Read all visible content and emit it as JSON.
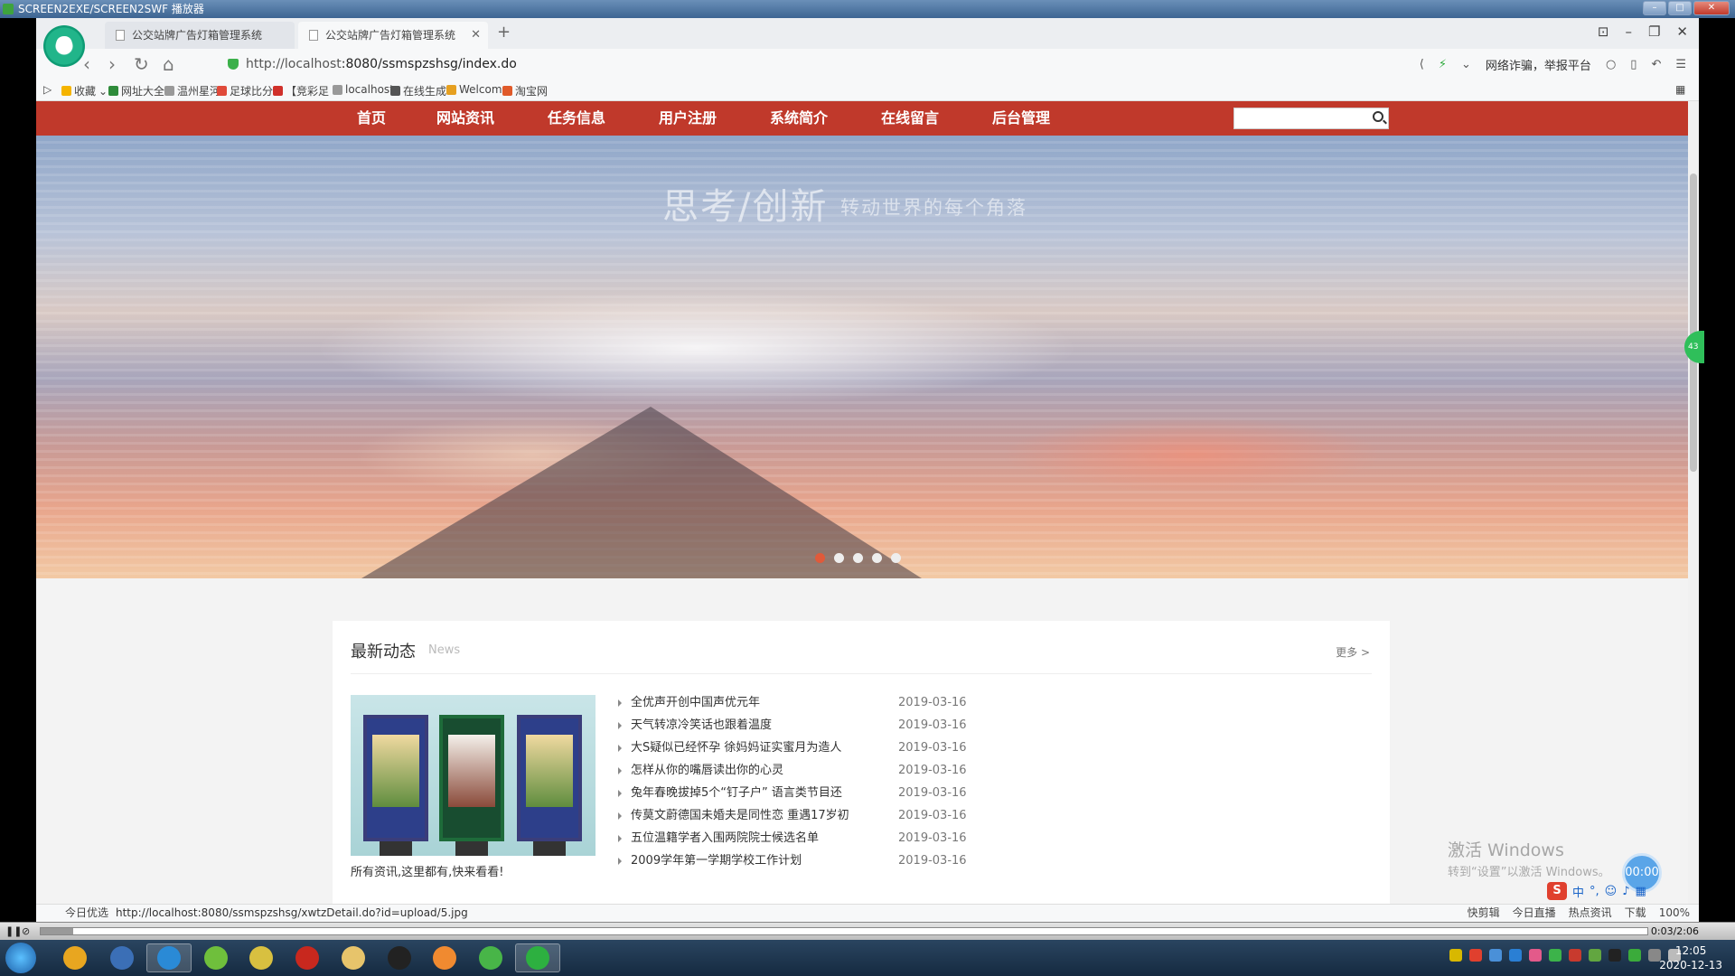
{
  "player": {
    "title": "SCREEN2EXE/SCREEN2SWF 播放器",
    "time": "0:03/2:06"
  },
  "browser": {
    "tabs": [
      {
        "label": "公交站牌广告灯箱管理系统",
        "active": false
      },
      {
        "label": "公交站牌广告灯箱管理系统",
        "active": true
      }
    ],
    "url_host": "http://localhost",
    "url_rest": ":8080/ssmspzshsg/index.do",
    "fraud_report": "网络诈骗，举报平台",
    "bookmarks": [
      "收藏",
      "网址大全",
      "温州星河",
      "足球比分",
      "【竞彩足",
      "localhost",
      "在线生成",
      "Welcom",
      "淘宝网"
    ],
    "bookmark_colors": [
      "#f5b400",
      "#2e8b3a",
      "#999999",
      "#e04a3a",
      "#d0302a",
      "#999999",
      "#555555",
      "#e6a020",
      "#e05a2a"
    ]
  },
  "site": {
    "menu": [
      "首页",
      "网站资讯",
      "任务信息",
      "用户注册",
      "系统简介",
      "在线留言",
      "后台管理"
    ],
    "search_placeholder": "",
    "banner": {
      "title": "思考/创新",
      "subtitle": "转动世界的每个角落",
      "slide_count": 5,
      "active_slide": 0
    },
    "news": {
      "title": "最新动态",
      "title_en": "News",
      "more": "更多 >",
      "caption": "所有资讯,这里都有,快来看看!",
      "items": [
        {
          "title": "全优声开创中国声优元年",
          "date": "2019-03-16"
        },
        {
          "title": "天气转凉冷笑话也跟着温度",
          "date": "2019-03-16"
        },
        {
          "title": "大S疑似已经怀孕 徐妈妈证实蜜月为造人",
          "date": "2019-03-16"
        },
        {
          "title": "怎样从你的嘴唇读出你的心灵",
          "date": "2019-03-16"
        },
        {
          "title": "兔年春晚拔掉5个“钉子户” 语言类节目还",
          "date": "2019-03-16"
        },
        {
          "title": "传莫文蔚德国未婚夫是同性恋 重遇17岁初",
          "date": "2019-03-16"
        },
        {
          "title": "五位温籍学者入围两院院士候选名单",
          "date": "2019-03-16"
        },
        {
          "title": "2009学年第一学期学校工作计划",
          "date": "2019-03-16"
        }
      ]
    }
  },
  "overlay": {
    "timer": "00:00",
    "activate_title": "激活 Windows",
    "activate_sub": "转到“设置”以激活 Windows。",
    "side_badge": "43"
  },
  "status_bar": {
    "left": "今日优选",
    "url": "http://localhost:8080/ssmspzshsg/xwtzDetail.do?id=upload/5.jpg",
    "right": [
      "快剪辑",
      "今日直播",
      "热点资讯",
      "下载",
      "100%"
    ]
  },
  "taskbar": {
    "time": "12:05",
    "date": "2020-12-13",
    "app_colors": [
      "#e8a620",
      "#3b6fb6",
      "#2a8ad6",
      "#6fbf3c",
      "#d8c040",
      "#c8281e",
      "#e7c46b",
      "#222222",
      "#f08a30",
      "#48b548",
      "#2db040"
    ]
  }
}
